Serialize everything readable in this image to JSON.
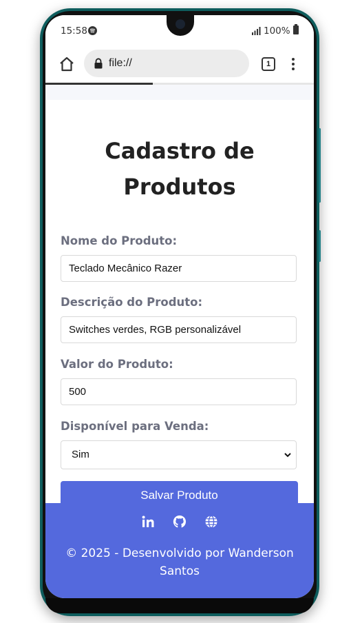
{
  "status": {
    "time": "15:58",
    "battery_text": "100%"
  },
  "browser": {
    "url": "file://",
    "tab_count": "1",
    "load_progress": 0.4
  },
  "page": {
    "title_line1": "Cadastro de",
    "title_line2": "Produtos",
    "fields": [
      {
        "label": "Nome do Produto:",
        "value": "Teclado Mecânico Razer"
      },
      {
        "label": "Descrição do Produto:",
        "value": "Switches verdes, RGB personalizável"
      },
      {
        "label": "Valor do Produto:",
        "value": "500"
      }
    ],
    "availability": {
      "label": "Disponível para Venda:",
      "selected": "Sim"
    },
    "save_label": "Salvar Produto"
  },
  "footer": {
    "icons": [
      "linkedin-icon",
      "github-icon",
      "globe-icon"
    ],
    "text_line1": "© 2025 - Desenvolvido por Wanderson",
    "text_line2": "Santos"
  },
  "colors": {
    "accent": "#5469dd",
    "label": "#6c6f7f",
    "title": "#222222"
  }
}
